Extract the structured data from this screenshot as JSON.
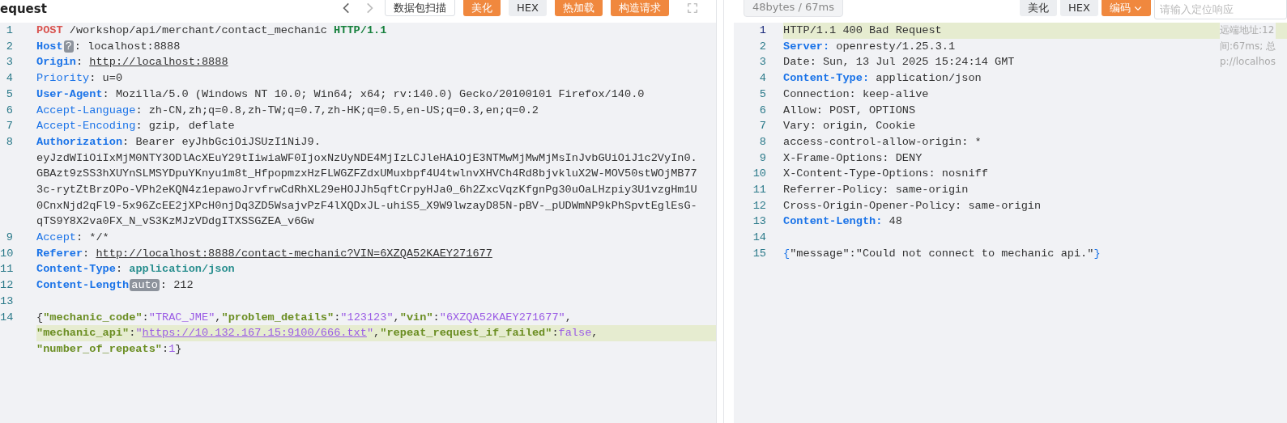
{
  "request_panel": {
    "title": "equest",
    "buttons": [
      {
        "label": "数据包扫描",
        "kind": "outline"
      },
      {
        "label": "美化",
        "kind": "orange"
      },
      {
        "label": "HEX",
        "kind": "gray"
      },
      {
        "label": "热加载",
        "kind": "orange"
      },
      {
        "label": "构造请求",
        "kind": "orange"
      }
    ],
    "lines": [
      {
        "number": "1",
        "highlighted": false,
        "tokens": [
          {
            "kind": "method",
            "text": "POST"
          },
          {
            "kind": "text",
            "text": " /workshop/api/merchant/contact_mechanic "
          },
          {
            "kind": "version",
            "text": "HTTP/1.1"
          }
        ]
      },
      {
        "number": "2",
        "highlighted": false,
        "tokens": [
          {
            "kind": "key",
            "text": "Host"
          },
          {
            "kind": "badge",
            "text": "?"
          },
          {
            "kind": "text",
            "text": ": localhost:8888"
          }
        ]
      },
      {
        "number": "3",
        "highlighted": false,
        "tokens": [
          {
            "kind": "key",
            "text": "Origin"
          },
          {
            "kind": "text",
            "text": ": "
          },
          {
            "kind": "link",
            "text": "http://localhost:8888"
          }
        ]
      },
      {
        "number": "4",
        "highlighted": false,
        "tokens": [
          {
            "kind": "key-plain",
            "text": "Priority"
          },
          {
            "kind": "text",
            "text": ": u=0"
          }
        ]
      },
      {
        "number": "5",
        "highlighted": false,
        "tokens": [
          {
            "kind": "key",
            "text": "User-Agent"
          },
          {
            "kind": "text",
            "text": ": Mozilla/5.0 (Windows NT 10.0; Win64; x64; rv:140.0) Gecko/20100101 Firefox/140.0"
          }
        ]
      },
      {
        "number": "6",
        "highlighted": false,
        "tokens": [
          {
            "kind": "key-plain",
            "text": "Accept-Language"
          },
          {
            "kind": "text",
            "text": ": zh-CN,zh;q=0.8,zh-TW;q=0.7,zh-HK;q=0.5,en-US;q=0.3,en;q=0.2"
          }
        ]
      },
      {
        "number": "7",
        "highlighted": false,
        "tokens": [
          {
            "kind": "key-plain",
            "text": "Accept-Encoding"
          },
          {
            "kind": "text",
            "text": ": gzip, deflate"
          }
        ]
      },
      {
        "number": "8",
        "rows": [
          {
            "highlighted": false,
            "tokens": [
              {
                "kind": "key",
                "text": "Authorization"
              },
              {
                "kind": "text",
                "text": ": Bearer eyJhbGciOiJSUzI1NiJ9."
              }
            ]
          },
          {
            "highlighted": false,
            "tokens": [
              {
                "kind": "text",
                "text": "eyJzdWIiOiIxMjM0NTY3ODlAcXEuY29tIiwiaWF0IjoxNzUyNDE4MjIzLCJleHAiOjE3NTMwMjMwMjMsInJvbGUiOiJ1c2VyIn0."
              }
            ]
          },
          {
            "highlighted": false,
            "tokens": [
              {
                "kind": "text",
                "text": "GBAzt9zSS3hXUYnSLMSYDpuYKnyu1m8t_HfpopmzxHzFLWGZFZdxUMuxbpf4U4twlnvXHVCh4Rd8bjvkluX2W-MOV50stWOjMB77"
              }
            ]
          },
          {
            "highlighted": false,
            "tokens": [
              {
                "kind": "text",
                "text": "3c-rytZtBrzOPo-VPh2eKQN4z1epawoJrvfrwCdRhXL29eHOJJh5qftCrpyHJa0_6h2ZxcVqzKfgnPg30uOaLHzpiy3U1vzgHm1U"
              }
            ]
          },
          {
            "highlighted": false,
            "tokens": [
              {
                "kind": "text",
                "text": "0CnxNjd2qFl9-5x96ZcEE2jXPcH0njDq3ZD5WsajvPzF4lXQDxJL-uhiS5_X9W9lwzayD85N-pBV-_pUDWmNP9kPhSpvtEglEsG-"
              }
            ]
          },
          {
            "highlighted": false,
            "tokens": [
              {
                "kind": "text",
                "text": "qTS9Y8X2va0FX_N_vS3KzMJzVDdgITXSSGZEA_v6Gw"
              }
            ]
          }
        ]
      },
      {
        "number": "9",
        "highlighted": false,
        "tokens": [
          {
            "kind": "key-plain",
            "text": "Accept"
          },
          {
            "kind": "text",
            "text": ": */*"
          }
        ]
      },
      {
        "number": "10",
        "highlighted": false,
        "tokens": [
          {
            "kind": "key",
            "text": "Referer"
          },
          {
            "kind": "text",
            "text": ": "
          },
          {
            "kind": "link",
            "text": "http://localhost:8888/contact-mechanic?VIN=6XZQA52KAEY271677"
          }
        ]
      },
      {
        "number": "11",
        "highlighted": false,
        "tokens": [
          {
            "kind": "key",
            "text": "Content-Type"
          },
          {
            "kind": "text",
            "text": ": "
          },
          {
            "kind": "ctype",
            "text": "application/json"
          }
        ]
      },
      {
        "number": "12",
        "highlighted": false,
        "tokens": [
          {
            "kind": "key",
            "text": "Content-Length"
          },
          {
            "kind": "badge",
            "text": "auto"
          },
          {
            "kind": "text",
            "text": ": 212"
          }
        ]
      },
      {
        "number": "13",
        "highlighted": false
      },
      {
        "number": "14",
        "rows": [
          {
            "highlighted": false,
            "tokens": [
              {
                "kind": "text",
                "text": "{"
              },
              {
                "kind": "jkey",
                "text": "\"mechanic_code\""
              },
              {
                "kind": "text",
                "text": ":"
              },
              {
                "kind": "jstr",
                "text": "\"TRAC_JME\""
              },
              {
                "kind": "text",
                "text": ","
              },
              {
                "kind": "jkey",
                "text": "\"problem_details\""
              },
              {
                "kind": "text",
                "text": ":"
              },
              {
                "kind": "jstr",
                "text": "\"123123\""
              },
              {
                "kind": "text",
                "text": ","
              },
              {
                "kind": "jkey",
                "text": "\"vin\""
              },
              {
                "kind": "text",
                "text": ":"
              },
              {
                "kind": "jstr",
                "text": "\"6XZQA52KAEY271677\""
              },
              {
                "kind": "text",
                "text": ","
              }
            ]
          },
          {
            "highlighted": true,
            "tokens": [
              {
                "kind": "jkey",
                "text": "\"mechanic_api\""
              },
              {
                "kind": "text",
                "text": ":"
              },
              {
                "kind": "jstr",
                "text": "\""
              },
              {
                "kind": "jlink",
                "text": "https://10.132.167.15:9100/666.txt"
              },
              {
                "kind": "jstr",
                "text": "\""
              },
              {
                "kind": "text",
                "text": ","
              },
              {
                "kind": "jkey",
                "text": "\"repeat_request_if_failed\""
              },
              {
                "kind": "text",
                "text": ":"
              },
              {
                "kind": "jstr",
                "text": "false"
              },
              {
                "kind": "text",
                "text": ","
              }
            ]
          },
          {
            "highlighted": false,
            "tokens": [
              {
                "kind": "jkey",
                "text": "\"number_of_repeats\""
              },
              {
                "kind": "text",
                "text": ":"
              },
              {
                "kind": "jstr",
                "text": "1"
              },
              {
                "kind": "text",
                "text": "}"
              }
            ]
          }
        ]
      }
    ]
  },
  "response_panel": {
    "stats": "48bytes / 67ms",
    "buttons": [
      {
        "label": "美化",
        "kind": "gray",
        "dropdown": false
      },
      {
        "label": "HEX",
        "kind": "gray",
        "dropdown": false
      },
      {
        "label": "编码",
        "kind": "orange",
        "dropdown": true
      }
    ],
    "search": {
      "placeholder": "请输入定位响应"
    },
    "side_notes": [
      "远端地址:12",
      "间:67ms; 总",
      "p://localhos"
    ],
    "lines": [
      {
        "number": "1",
        "highlighted": true,
        "tokens": [
          {
            "kind": "text",
            "text": "HTTP/1.1 400 Bad Request"
          }
        ]
      },
      {
        "number": "2",
        "highlighted": false,
        "tokens": [
          {
            "kind": "key",
            "text": "Server:"
          },
          {
            "kind": "text",
            "text": " openresty/1.25.3.1"
          }
        ]
      },
      {
        "number": "3",
        "highlighted": false,
        "tokens": [
          {
            "kind": "text",
            "text": "Date: Sun, 13 Jul 2025 15:24:14 GMT"
          }
        ]
      },
      {
        "number": "4",
        "highlighted": false,
        "tokens": [
          {
            "kind": "key",
            "text": "Content-Type:"
          },
          {
            "kind": "text",
            "text": " application/json"
          }
        ]
      },
      {
        "number": "5",
        "highlighted": false,
        "tokens": [
          {
            "kind": "text",
            "text": "Connection: keep-alive"
          }
        ]
      },
      {
        "number": "6",
        "highlighted": false,
        "tokens": [
          {
            "kind": "text",
            "text": "Allow: POST, OPTIONS"
          }
        ]
      },
      {
        "number": "7",
        "highlighted": false,
        "tokens": [
          {
            "kind": "text",
            "text": "Vary: origin, Cookie"
          }
        ]
      },
      {
        "number": "8",
        "highlighted": false,
        "tokens": [
          {
            "kind": "text",
            "text": "access-control-allow-origin: *"
          }
        ]
      },
      {
        "number": "9",
        "highlighted": false,
        "tokens": [
          {
            "kind": "text",
            "text": "X-Frame-Options: DENY"
          }
        ]
      },
      {
        "number": "10",
        "highlighted": false,
        "tokens": [
          {
            "kind": "text",
            "text": "X-Content-Type-Options: nosniff"
          }
        ]
      },
      {
        "number": "11",
        "highlighted": false,
        "tokens": [
          {
            "kind": "text",
            "text": "Referrer-Policy: same-origin"
          }
        ]
      },
      {
        "number": "12",
        "highlighted": false,
        "tokens": [
          {
            "kind": "text",
            "text": "Cross-Origin-Opener-Policy: same-origin"
          }
        ]
      },
      {
        "number": "13",
        "highlighted": false,
        "tokens": [
          {
            "kind": "key",
            "text": "Content-Length:"
          },
          {
            "kind": "text",
            "text": " 48"
          }
        ]
      },
      {
        "number": "14",
        "highlighted": false
      },
      {
        "number": "15",
        "highlighted": false,
        "tokens": [
          {
            "kind": "brace",
            "text": "{"
          },
          {
            "kind": "text",
            "text": "\"message\":\"Could not connect to mechanic api.\""
          },
          {
            "kind": "brace",
            "text": "}"
          }
        ]
      }
    ]
  }
}
